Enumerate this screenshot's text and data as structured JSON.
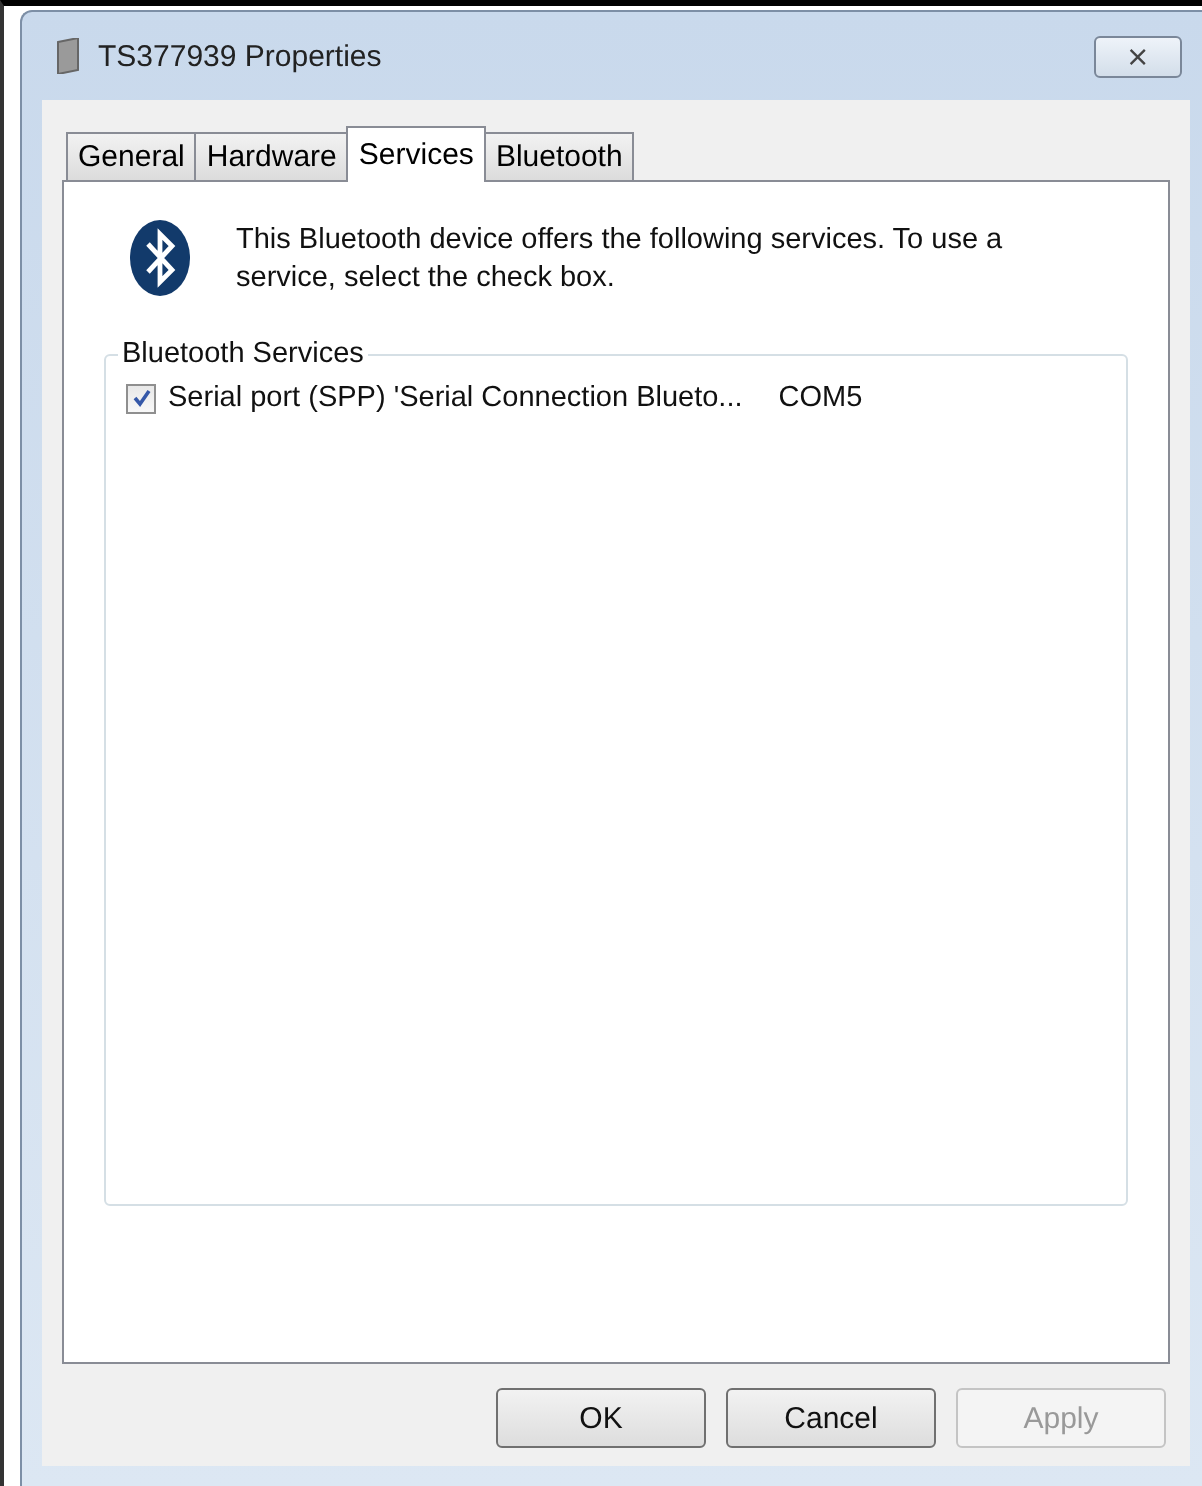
{
  "window": {
    "title": "TS377939 Properties",
    "close": "⨯"
  },
  "tabs": [
    {
      "label": "General",
      "selected": false
    },
    {
      "label": "Hardware",
      "selected": false
    },
    {
      "label": "Services",
      "selected": true
    },
    {
      "label": "Bluetooth",
      "selected": false
    }
  ],
  "intro": "This Bluetooth device offers the following services. To use a service, select the check box.",
  "group": {
    "title": "Bluetooth Services",
    "services": [
      {
        "name": "Serial port (SPP) 'Serial Connection Blueto...",
        "port": "COM5",
        "checked": true
      }
    ]
  },
  "buttons": [
    {
      "label": "OK",
      "disabled": false
    },
    {
      "label": "Cancel",
      "disabled": false
    },
    {
      "label": "Apply",
      "disabled": true
    }
  ]
}
